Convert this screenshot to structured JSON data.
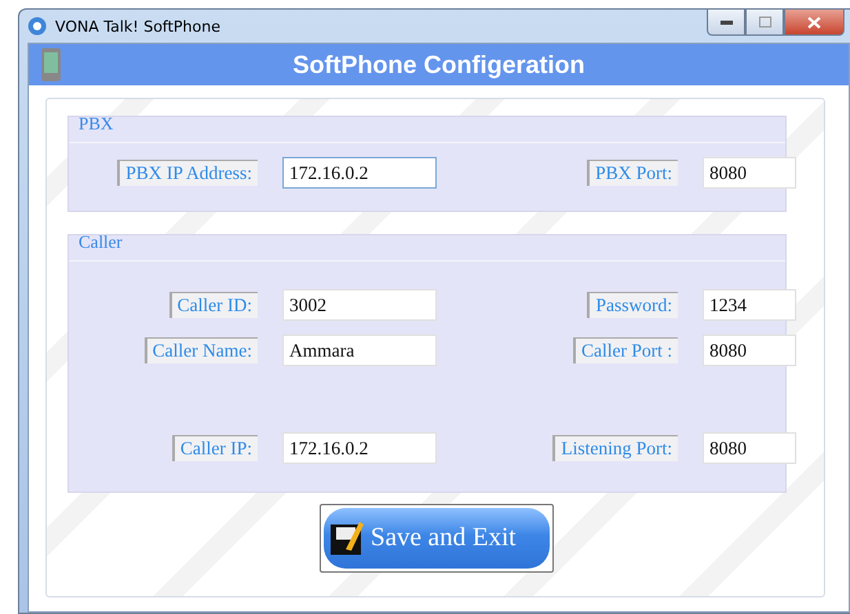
{
  "window": {
    "title": "VONA Talk! SoftPhone"
  },
  "header": {
    "title": "SoftPhone Configeration"
  },
  "groups": [
    {
      "title": "PBX",
      "rows": [
        {
          "fields": [
            {
              "label": "PBX IP Address:",
              "value": "172.16.0.2"
            },
            {
              "label": "PBX Port:",
              "value": "8080"
            }
          ]
        }
      ]
    },
    {
      "title": "Caller",
      "rows": [
        {
          "fields": [
            {
              "label": "Caller ID:",
              "value": "3002"
            },
            {
              "label": "Password:",
              "value": "1234"
            }
          ]
        },
        {
          "fields": [
            {
              "label": "Caller Name:",
              "value": "Ammara"
            },
            {
              "label": "Caller Port :",
              "value": "8080"
            }
          ]
        },
        {
          "fields": [
            {
              "label": "Caller IP:",
              "value": "172.16.0.2"
            },
            {
              "label": "Listening Port:",
              "value": "8080"
            }
          ]
        }
      ]
    }
  ],
  "button": {
    "label": "Save and Exit"
  }
}
